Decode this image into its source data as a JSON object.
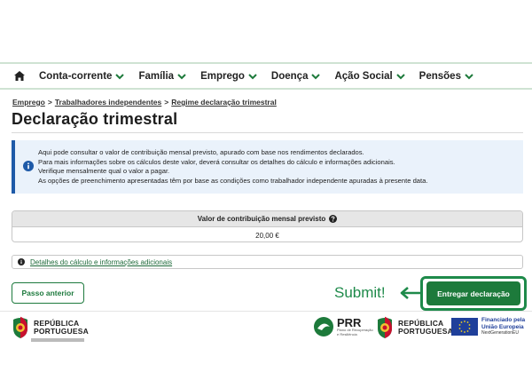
{
  "nav": {
    "items": [
      {
        "label": "Conta-corrente"
      },
      {
        "label": "Família"
      },
      {
        "label": "Emprego"
      },
      {
        "label": "Doença"
      },
      {
        "label": "Ação Social"
      },
      {
        "label": "Pensões"
      }
    ]
  },
  "breadcrumb": {
    "items": [
      "Emprego",
      "Trabalhadores independentes",
      "Regime declaração trimestral"
    ],
    "separator": ">"
  },
  "page": {
    "title": "Declaração trimestral"
  },
  "info": {
    "lines": [
      "Aqui pode consultar o valor de contribuição mensal previsto, apurado com base nos rendimentos declarados.",
      "Para mais informações sobre os cálculos deste valor, deverá consultar os detalhes do cálculo e informações adicionais.",
      "Verifique mensalmente qual o valor a pagar.",
      "As opções de preenchimento apresentadas têm por base as condições como trabalhador independente apuradas à presente data."
    ]
  },
  "table": {
    "header": "Valor de contribuição mensal previsto",
    "value": "20,00 €"
  },
  "details": {
    "link": "Detalhes do cálculo e informações adicionais"
  },
  "buttons": {
    "previous": "Passo anterior",
    "submit": "Entregar declaração"
  },
  "annotation": {
    "label": "Submit!",
    "color": "#1e8a4a"
  },
  "footer": {
    "rp_line1": "REPÚBLICA",
    "rp_line2": "PORTUGUESA",
    "prr_label": "PRR",
    "prr_sub1": "Plano de Recuperação",
    "prr_sub2": "e Resiliência",
    "eu_line1": "Financiado pela",
    "eu_line2": "União Europeia",
    "eu_line3": "NextGenerationEU"
  },
  "colors": {
    "brand_green": "#1d7a3b",
    "info_blue": "#1e5aa8",
    "info_bg": "#eaf2fb"
  }
}
